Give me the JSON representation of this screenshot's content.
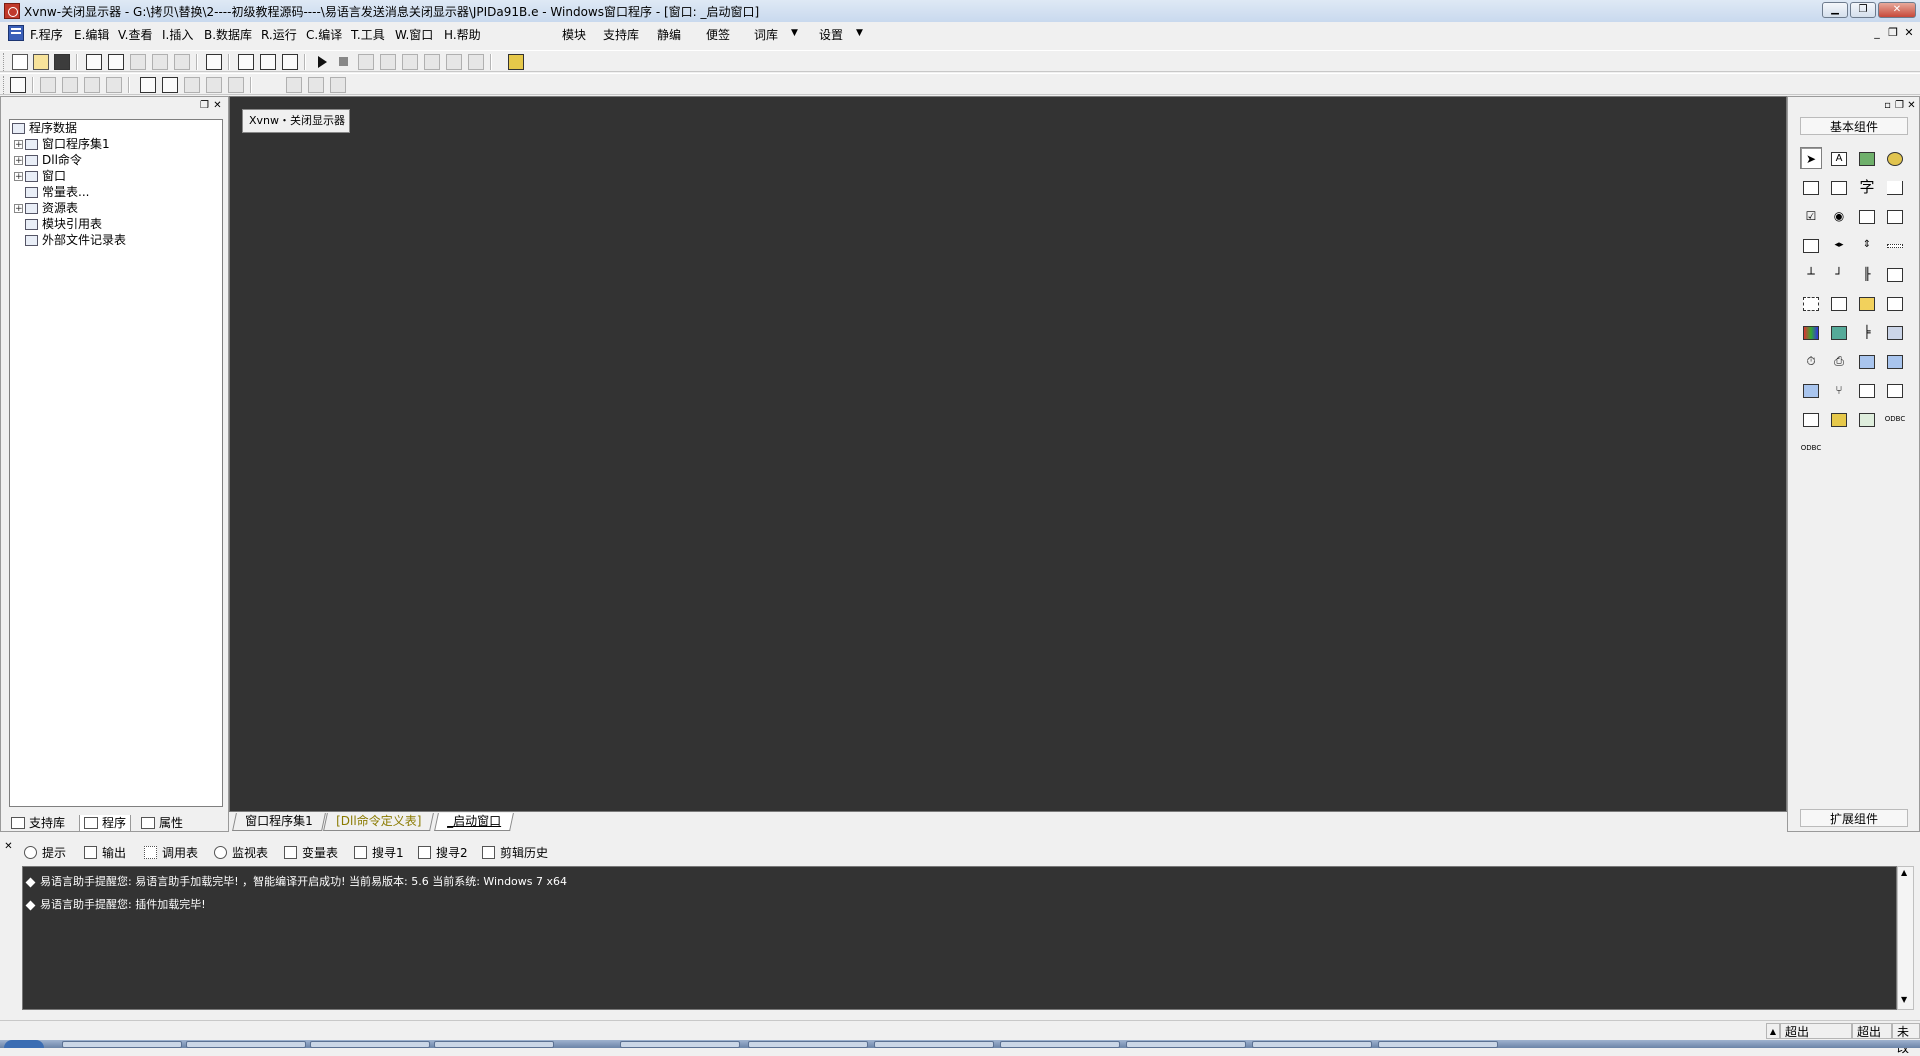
{
  "window": {
    "title": "Xvnw-关闭显示器 - G:\\拷贝\\替换\\2----初级教程源码----\\易语言发送消息关闭显示器\\JPIDa91B.e - Windows窗口程序 - [窗口: _启动窗口]",
    "minimize_label": "▁",
    "maximize_label": "❐",
    "close_label": "✕"
  },
  "menu": {
    "items": [
      "F.程序",
      "E.编辑",
      "V.查看",
      "I.插入",
      "B.数据库",
      "R.运行",
      "C.编译",
      "T.工具",
      "W.窗口",
      "H.帮助"
    ],
    "extras": [
      "模块",
      "支持库",
      "静编",
      "便签",
      "词库",
      "设置"
    ],
    "dropdown_arrow": "▼",
    "mdi_minimize": "_",
    "mdi_restore": "❐",
    "mdi_close": "✕"
  },
  "left_panel": {
    "tree": [
      {
        "label": "程序数据",
        "expander": "",
        "icon": "database-icon"
      },
      {
        "label": "窗口程序集1",
        "expander": "+",
        "icon": "module-icon"
      },
      {
        "label": "Dll命令",
        "expander": "+",
        "icon": "dll-icon"
      },
      {
        "label": "窗口",
        "expander": "+",
        "icon": "window-icon"
      },
      {
        "label": "常量表...",
        "expander": "",
        "icon": "constant-icon"
      },
      {
        "label": "资源表",
        "expander": "+",
        "icon": "resource-icon"
      },
      {
        "label": "模块引用表",
        "expander": "",
        "icon": "module-ref-icon"
      },
      {
        "label": "外部文件记录表",
        "expander": "",
        "icon": "file-record-icon"
      }
    ],
    "bottom_tabs": [
      "支持库",
      "程序",
      "属性"
    ],
    "ctrl_restore": "❐",
    "ctrl_close": "✕"
  },
  "editor": {
    "window_preview_title": "Xvnw・关闭显示器",
    "tabs": [
      "窗口程序集1",
      "[Dll命令定义表]",
      "_启动窗口"
    ],
    "active_tab": 2
  },
  "right_panel": {
    "header": "基本组件",
    "footer": "扩展组件",
    "text_glyphs": {
      "label": "A",
      "char": "字",
      "odbc": "ODBC"
    }
  },
  "output": {
    "tabs": [
      "提示",
      "输出",
      "调用表",
      "监视表",
      "变量表",
      "搜寻1",
      "搜寻2",
      "剪辑历史"
    ],
    "messages": [
      "易语言助手提醒您: 易语言助手加载完毕! ，智能编译开启成功! 当前易版本: 5.6 当前系统: Windows 7 x64",
      "易语言助手提醒您: 插件加载完毕!"
    ],
    "close_label": "✕"
  },
  "statusbar": {
    "cells": [
      "超出",
      "超出",
      "未改"
    ]
  },
  "colors": {
    "editor_bg": "#333333",
    "title_gradient_top": "#dfe9f5",
    "panel_bg": "#f0f0f0"
  }
}
